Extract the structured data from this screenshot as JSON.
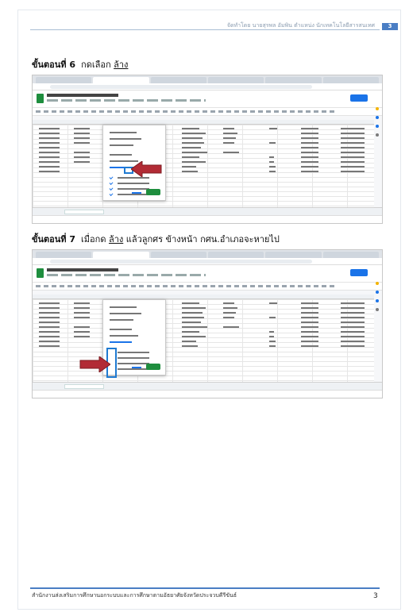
{
  "header": {
    "org_line": "จัดทำโดย นายสุรพล อัมพิน ตำแหน่ง นักเทคโนโลยีสารสนเทศ",
    "page_badge": "3"
  },
  "steps": [
    {
      "label": "ขั้นตอนที่ 6",
      "text_before": "กดเลือก",
      "underlined": "ล้าง",
      "text_after": ""
    },
    {
      "label": "ขั้นตอนที่ 7",
      "text_before": "เมื่อกด",
      "underlined": "ล้าง",
      "text_after": "แล้วลูกศร ข้างหน้า กศน.อำเภอจะหายไป"
    }
  ],
  "footer": {
    "text": "สำนักงานส่งเสริมการศึกษานอกระบบและการศึกษาตามอัธยาศัยจังหวัดประจวบคีรีขันธ์",
    "page_number": "3"
  },
  "colors": {
    "accent": "#4a7ec4",
    "arrow": "#b22b35",
    "highlight": "#1f7ad1",
    "ok_button": "#1e8e3e"
  },
  "icons": [
    "red-arrow-icon",
    "sheets-doc-icon",
    "checkmark-icon"
  ]
}
